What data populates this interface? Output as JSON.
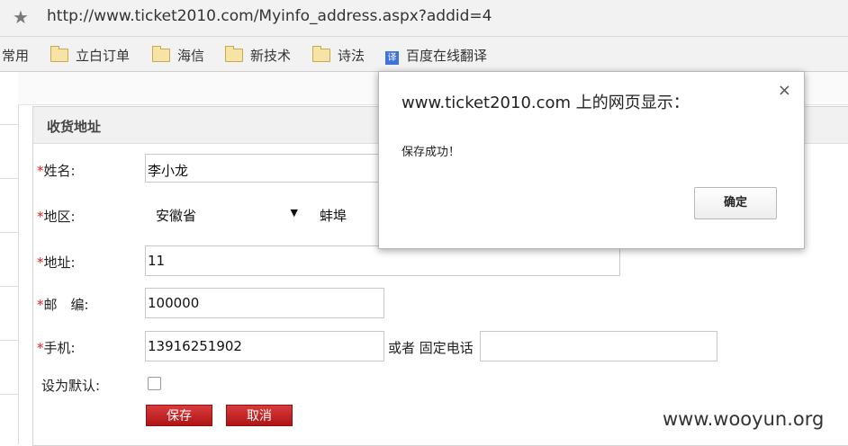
{
  "browser": {
    "url": "http://www.ticket2010.com/Myinfo_address.aspx?addid=4",
    "bookmarks": [
      "常用",
      "立白订单",
      "海信",
      "新技术",
      "诗法",
      "百度在线翻译"
    ]
  },
  "form": {
    "section_title": "收货地址",
    "required_mark": "*",
    "name_label": "姓名:",
    "name_value": "李小龙",
    "region_label": "地区:",
    "province_value": "安徽省",
    "city_value": "蚌埠",
    "address_label": "地址:",
    "address_value": "11",
    "postcode_label": "邮　编:",
    "postcode_value": "100000",
    "mobile_label": "手机:",
    "mobile_value": "13916251902",
    "phone_label": "或者 固定电话",
    "phone_value": "",
    "default_label": "设为默认:",
    "save_button": "保存",
    "cancel_button": "取消"
  },
  "dialog": {
    "title": "www.ticket2010.com 上的网页显示：",
    "close": "×",
    "message": "保存成功！",
    "ok_button": "确定"
  },
  "watermark": "www.wooyun.org"
}
